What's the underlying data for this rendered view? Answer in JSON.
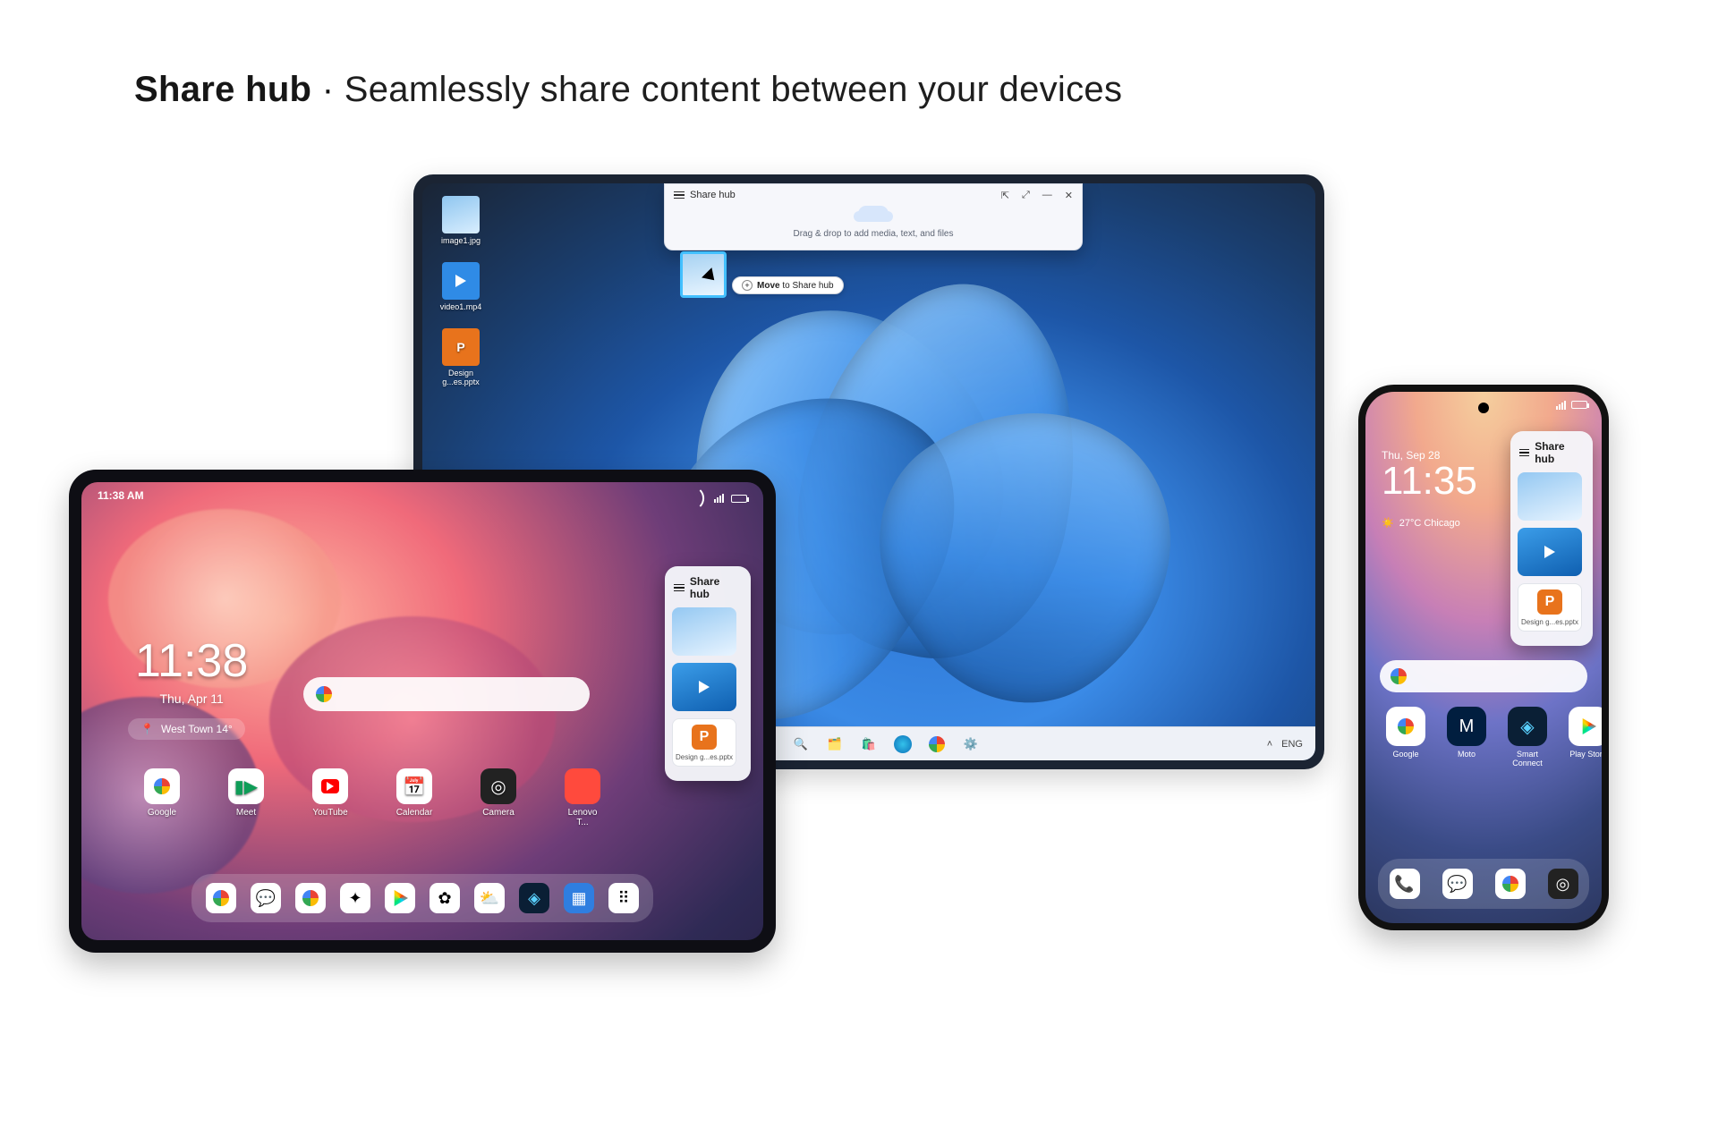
{
  "title": {
    "heading": "Share hub",
    "separator": " · ",
    "sub": "Seamlessly share content between your devices"
  },
  "laptop": {
    "files": {
      "img": "image1.jpg",
      "vid": "video1.mp4",
      "ppt": "Design g...es.pptx"
    },
    "hub": {
      "title": "Share hub",
      "hint": "Drag & drop to add media, text, and files",
      "pill_prefix": "Move",
      "pill_suffix": " to Share hub"
    },
    "taskbar": {
      "lang": "ENG"
    }
  },
  "shareHubPanel": {
    "title": "Share hub",
    "doc_label": "Design g...es.pptx"
  },
  "tablet": {
    "status_time": "11:38 AM",
    "clock_time": "11:38",
    "clock_date": "Thu, Apr 11",
    "weather": "West Town 14°",
    "apps": [
      "Google",
      "Meet",
      "YouTube",
      "Calendar",
      "Camera",
      "Lenovo T..."
    ]
  },
  "phone": {
    "status_date": "Thu, Sep 28",
    "clock_time": "11:35",
    "weather": "27°C Chicago",
    "apps": [
      "Google",
      "Moto",
      "Smart Connect",
      "Play Store"
    ]
  }
}
